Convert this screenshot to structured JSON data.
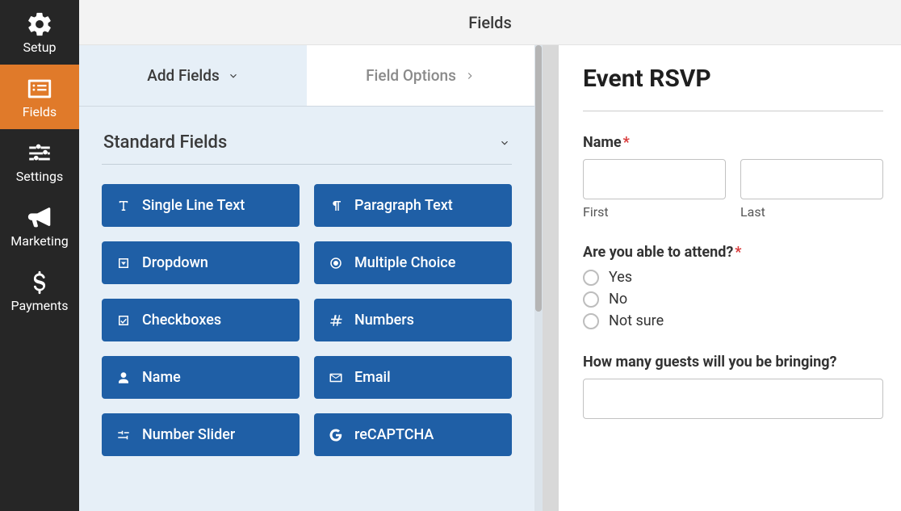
{
  "header": {
    "title": "Fields"
  },
  "rail": {
    "items": [
      {
        "id": "setup",
        "label": "Setup",
        "active": false
      },
      {
        "id": "fields",
        "label": "Fields",
        "active": true
      },
      {
        "id": "settings",
        "label": "Settings",
        "active": false
      },
      {
        "id": "marketing",
        "label": "Marketing",
        "active": false
      },
      {
        "id": "payments",
        "label": "Payments",
        "active": false
      }
    ]
  },
  "tabs": {
    "add_fields": "Add Fields",
    "field_options": "Field Options"
  },
  "section": {
    "title": "Standard Fields"
  },
  "fields": [
    {
      "id": "single-line-text",
      "label": "Single Line Text"
    },
    {
      "id": "paragraph-text",
      "label": "Paragraph Text"
    },
    {
      "id": "dropdown",
      "label": "Dropdown"
    },
    {
      "id": "multiple-choice",
      "label": "Multiple Choice"
    },
    {
      "id": "checkboxes",
      "label": "Checkboxes"
    },
    {
      "id": "numbers",
      "label": "Numbers"
    },
    {
      "id": "name",
      "label": "Name"
    },
    {
      "id": "email",
      "label": "Email"
    },
    {
      "id": "number-slider",
      "label": "Number Slider"
    },
    {
      "id": "recaptcha",
      "label": "reCAPTCHA"
    }
  ],
  "preview": {
    "title": "Event RSVP",
    "name_field": {
      "label": "Name",
      "first": "First",
      "last": "Last"
    },
    "attend_field": {
      "label": "Are you able to attend?",
      "options": [
        "Yes",
        "No",
        "Not sure"
      ]
    },
    "guests_field": {
      "label": "How many guests will you be bringing?"
    }
  }
}
